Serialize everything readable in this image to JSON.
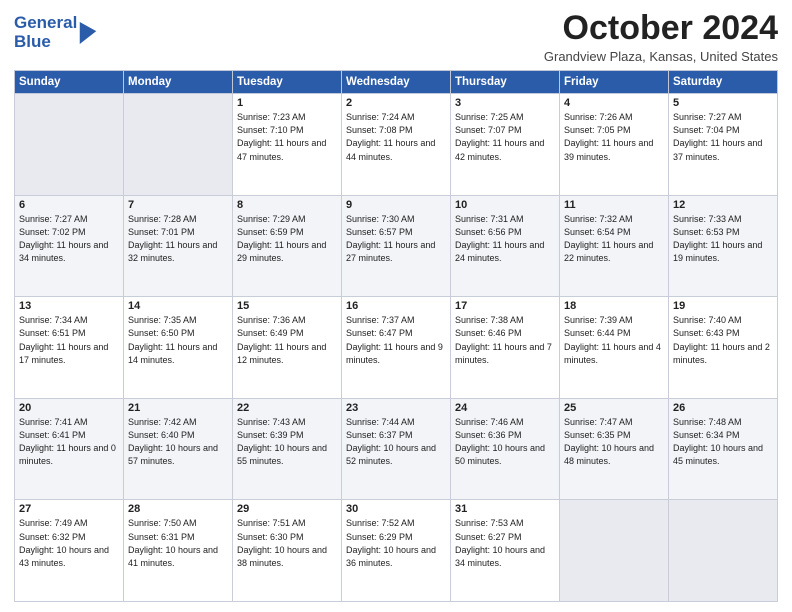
{
  "logo": {
    "line1": "General",
    "line2": "Blue"
  },
  "title": "October 2024",
  "location": "Grandview Plaza, Kansas, United States",
  "weekdays": [
    "Sunday",
    "Monday",
    "Tuesday",
    "Wednesday",
    "Thursday",
    "Friday",
    "Saturday"
  ],
  "weeks": [
    [
      {
        "day": "",
        "text": ""
      },
      {
        "day": "",
        "text": ""
      },
      {
        "day": "1",
        "text": "Sunrise: 7:23 AM\nSunset: 7:10 PM\nDaylight: 11 hours and 47 minutes."
      },
      {
        "day": "2",
        "text": "Sunrise: 7:24 AM\nSunset: 7:08 PM\nDaylight: 11 hours and 44 minutes."
      },
      {
        "day": "3",
        "text": "Sunrise: 7:25 AM\nSunset: 7:07 PM\nDaylight: 11 hours and 42 minutes."
      },
      {
        "day": "4",
        "text": "Sunrise: 7:26 AM\nSunset: 7:05 PM\nDaylight: 11 hours and 39 minutes."
      },
      {
        "day": "5",
        "text": "Sunrise: 7:27 AM\nSunset: 7:04 PM\nDaylight: 11 hours and 37 minutes."
      }
    ],
    [
      {
        "day": "6",
        "text": "Sunrise: 7:27 AM\nSunset: 7:02 PM\nDaylight: 11 hours and 34 minutes."
      },
      {
        "day": "7",
        "text": "Sunrise: 7:28 AM\nSunset: 7:01 PM\nDaylight: 11 hours and 32 minutes."
      },
      {
        "day": "8",
        "text": "Sunrise: 7:29 AM\nSunset: 6:59 PM\nDaylight: 11 hours and 29 minutes."
      },
      {
        "day": "9",
        "text": "Sunrise: 7:30 AM\nSunset: 6:57 PM\nDaylight: 11 hours and 27 minutes."
      },
      {
        "day": "10",
        "text": "Sunrise: 7:31 AM\nSunset: 6:56 PM\nDaylight: 11 hours and 24 minutes."
      },
      {
        "day": "11",
        "text": "Sunrise: 7:32 AM\nSunset: 6:54 PM\nDaylight: 11 hours and 22 minutes."
      },
      {
        "day": "12",
        "text": "Sunrise: 7:33 AM\nSunset: 6:53 PM\nDaylight: 11 hours and 19 minutes."
      }
    ],
    [
      {
        "day": "13",
        "text": "Sunrise: 7:34 AM\nSunset: 6:51 PM\nDaylight: 11 hours and 17 minutes."
      },
      {
        "day": "14",
        "text": "Sunrise: 7:35 AM\nSunset: 6:50 PM\nDaylight: 11 hours and 14 minutes."
      },
      {
        "day": "15",
        "text": "Sunrise: 7:36 AM\nSunset: 6:49 PM\nDaylight: 11 hours and 12 minutes."
      },
      {
        "day": "16",
        "text": "Sunrise: 7:37 AM\nSunset: 6:47 PM\nDaylight: 11 hours and 9 minutes."
      },
      {
        "day": "17",
        "text": "Sunrise: 7:38 AM\nSunset: 6:46 PM\nDaylight: 11 hours and 7 minutes."
      },
      {
        "day": "18",
        "text": "Sunrise: 7:39 AM\nSunset: 6:44 PM\nDaylight: 11 hours and 4 minutes."
      },
      {
        "day": "19",
        "text": "Sunrise: 7:40 AM\nSunset: 6:43 PM\nDaylight: 11 hours and 2 minutes."
      }
    ],
    [
      {
        "day": "20",
        "text": "Sunrise: 7:41 AM\nSunset: 6:41 PM\nDaylight: 11 hours and 0 minutes."
      },
      {
        "day": "21",
        "text": "Sunrise: 7:42 AM\nSunset: 6:40 PM\nDaylight: 10 hours and 57 minutes."
      },
      {
        "day": "22",
        "text": "Sunrise: 7:43 AM\nSunset: 6:39 PM\nDaylight: 10 hours and 55 minutes."
      },
      {
        "day": "23",
        "text": "Sunrise: 7:44 AM\nSunset: 6:37 PM\nDaylight: 10 hours and 52 minutes."
      },
      {
        "day": "24",
        "text": "Sunrise: 7:46 AM\nSunset: 6:36 PM\nDaylight: 10 hours and 50 minutes."
      },
      {
        "day": "25",
        "text": "Sunrise: 7:47 AM\nSunset: 6:35 PM\nDaylight: 10 hours and 48 minutes."
      },
      {
        "day": "26",
        "text": "Sunrise: 7:48 AM\nSunset: 6:34 PM\nDaylight: 10 hours and 45 minutes."
      }
    ],
    [
      {
        "day": "27",
        "text": "Sunrise: 7:49 AM\nSunset: 6:32 PM\nDaylight: 10 hours and 43 minutes."
      },
      {
        "day": "28",
        "text": "Sunrise: 7:50 AM\nSunset: 6:31 PM\nDaylight: 10 hours and 41 minutes."
      },
      {
        "day": "29",
        "text": "Sunrise: 7:51 AM\nSunset: 6:30 PM\nDaylight: 10 hours and 38 minutes."
      },
      {
        "day": "30",
        "text": "Sunrise: 7:52 AM\nSunset: 6:29 PM\nDaylight: 10 hours and 36 minutes."
      },
      {
        "day": "31",
        "text": "Sunrise: 7:53 AM\nSunset: 6:27 PM\nDaylight: 10 hours and 34 minutes."
      },
      {
        "day": "",
        "text": ""
      },
      {
        "day": "",
        "text": ""
      }
    ]
  ]
}
